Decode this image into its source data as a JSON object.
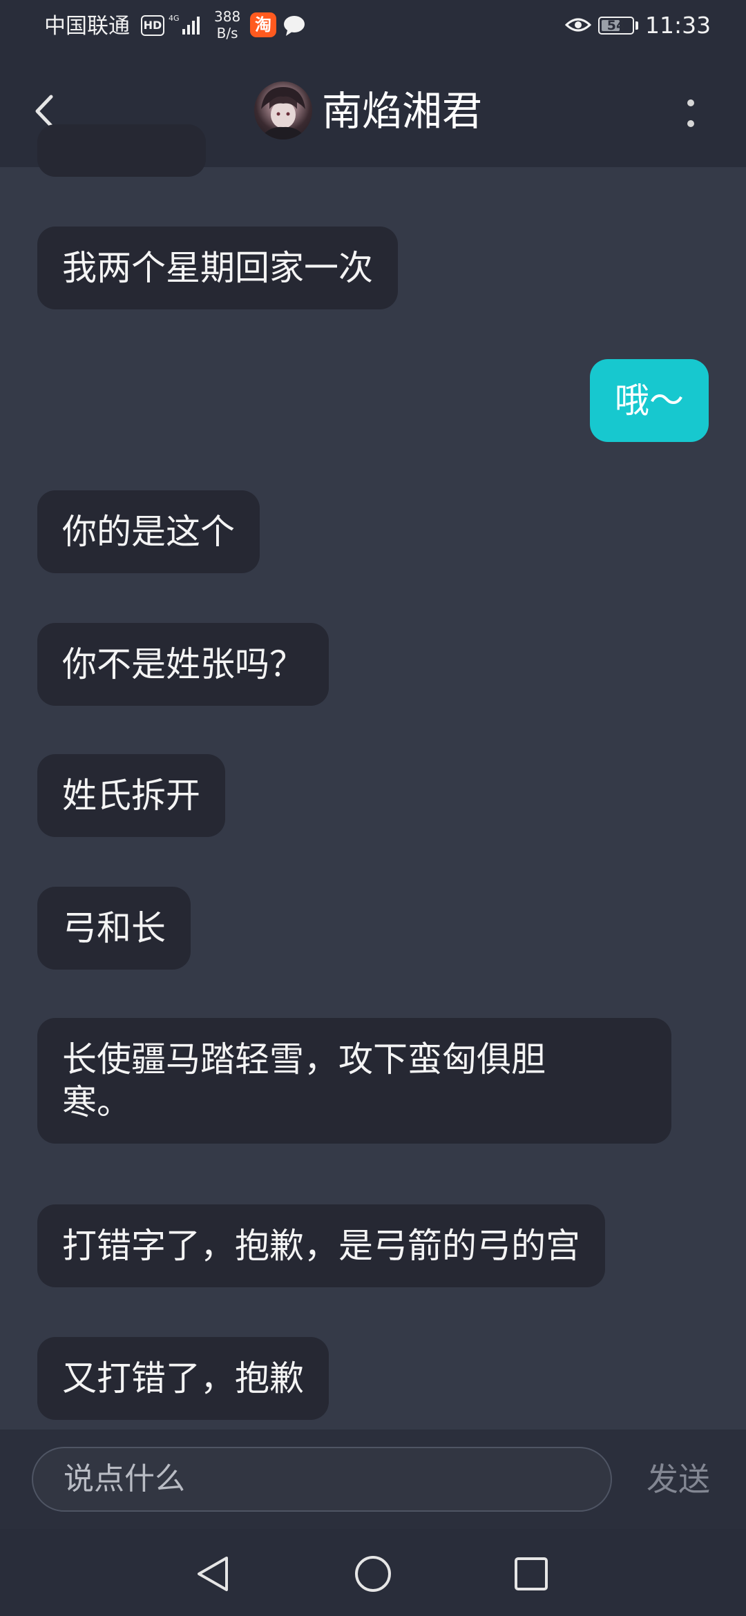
{
  "status_bar": {
    "carrier": "中国联通",
    "hd_badge": "HD",
    "network": "4G",
    "speed_value": "388",
    "speed_unit": "B/s",
    "taobao_glyph": "淘",
    "battery": "54",
    "time": "11:33",
    "icons": [
      "signal-icon",
      "taobao-app-icon",
      "chat-notification-icon",
      "eye-icon",
      "battery-icon"
    ]
  },
  "header": {
    "back_icon": "chevron-left-icon",
    "title": "南焰湘君",
    "more_icon": "more-vertical-icon"
  },
  "messages": [
    {
      "side": "left",
      "text": "我两个星期回家一次"
    },
    {
      "side": "right",
      "text": "哦～"
    },
    {
      "side": "left",
      "text": "你的是这个"
    },
    {
      "side": "left",
      "text": "你不是姓张吗？"
    },
    {
      "side": "left",
      "text": "姓氏拆开"
    },
    {
      "side": "left",
      "text": "弓和长"
    },
    {
      "side": "left",
      "text": "长使疆马踏轻雪，攻下蛮匈俱胆\n寒。"
    },
    {
      "side": "left",
      "text": "打错字了，抱歉，是弓箭的弓的宫"
    },
    {
      "side": "left",
      "text": "又打错了，抱歉"
    }
  ],
  "composer": {
    "placeholder": "说点什么",
    "send_label": "发送"
  },
  "nav": {
    "icons": [
      "back-triangle-icon",
      "home-circle-icon",
      "recents-square-icon"
    ]
  },
  "colors": {
    "background": "#353a48",
    "bar": "#292d3a",
    "incoming_bubble": "#262833",
    "outgoing_bubble": "#17c8cf"
  }
}
